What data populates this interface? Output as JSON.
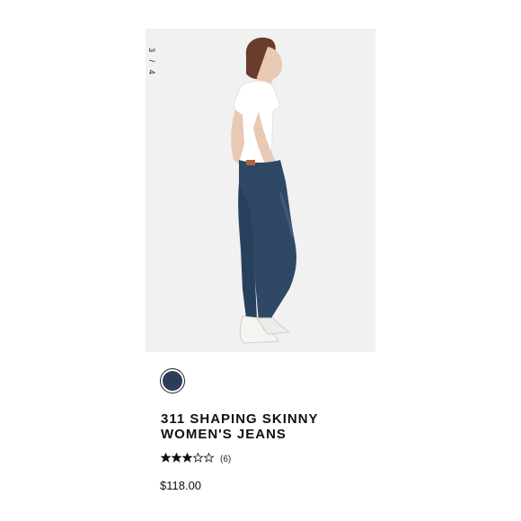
{
  "gallery": {
    "current": "3",
    "separator": "/",
    "total": "4"
  },
  "swatch": {
    "color": "#2c3e55"
  },
  "product": {
    "title_line1": "311 SHAPING SKINNY",
    "title_line2": "WOMEN'S JEANS",
    "rating": 3,
    "rating_max": 5,
    "review_count": "(6)",
    "price": "$118.00"
  }
}
